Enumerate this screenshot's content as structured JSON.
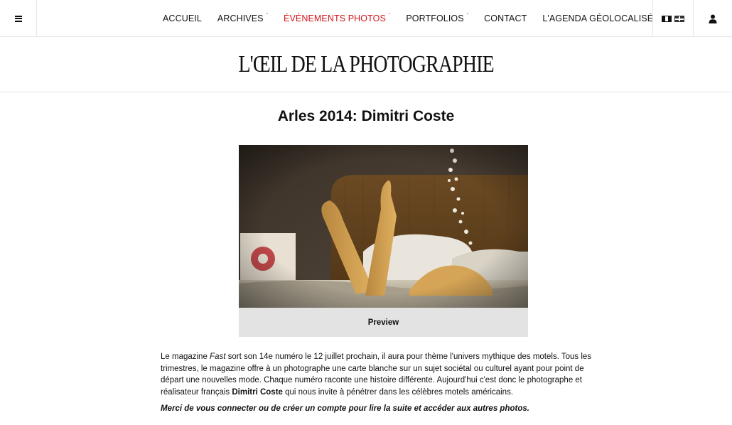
{
  "nav": {
    "items": [
      {
        "label": "ACCUEIL",
        "has_dropdown": false,
        "active": false
      },
      {
        "label": "ARCHIVES",
        "has_dropdown": true,
        "active": false
      },
      {
        "label": "ÉVÉNEMENTS PHOTOS",
        "has_dropdown": true,
        "active": true
      },
      {
        "label": "PORTFOLIOS",
        "has_dropdown": true,
        "active": false
      },
      {
        "label": "CONTACT",
        "has_dropdown": false,
        "active": false
      },
      {
        "label": "L'AGENDA GÉOLOCALISÉ",
        "has_dropdown": false,
        "active": false
      }
    ],
    "menu_icon": "hamburger-icon",
    "languages": [
      "fr-flag-icon",
      "uk-flag-icon"
    ],
    "user_icon": "user-icon",
    "active_color": "#d4141b"
  },
  "site": {
    "logo_text": "L'ŒIL DE LA PHOTOGRAPHIE"
  },
  "article": {
    "title": "Arles 2014: Dimitri Coste",
    "preview_label": "Preview",
    "body": {
      "p1": "Le magazine ",
      "magazine": "Fast",
      "p2": " sort son 14e numéro le 12 juillet prochain, il aura pour thème l'univers mythique des motels. Tous les trimestres, le magazine offre à un photographe une carte blanche sur un sujet sociétal ou culturel ayant pour point de départ une nouvelles mode. Chaque numéro raconte une histoire différente. Aujourd'hui c'est donc le photographe et réalisateur français ",
      "photographer": "Dimitri Coste",
      "p3": " qui nous invite à pénétrer dans les célèbres motels américains."
    },
    "login_notice": "Merci de vous connecter ou de créer un compte pour lire la suite et accéder aux autres photos."
  }
}
